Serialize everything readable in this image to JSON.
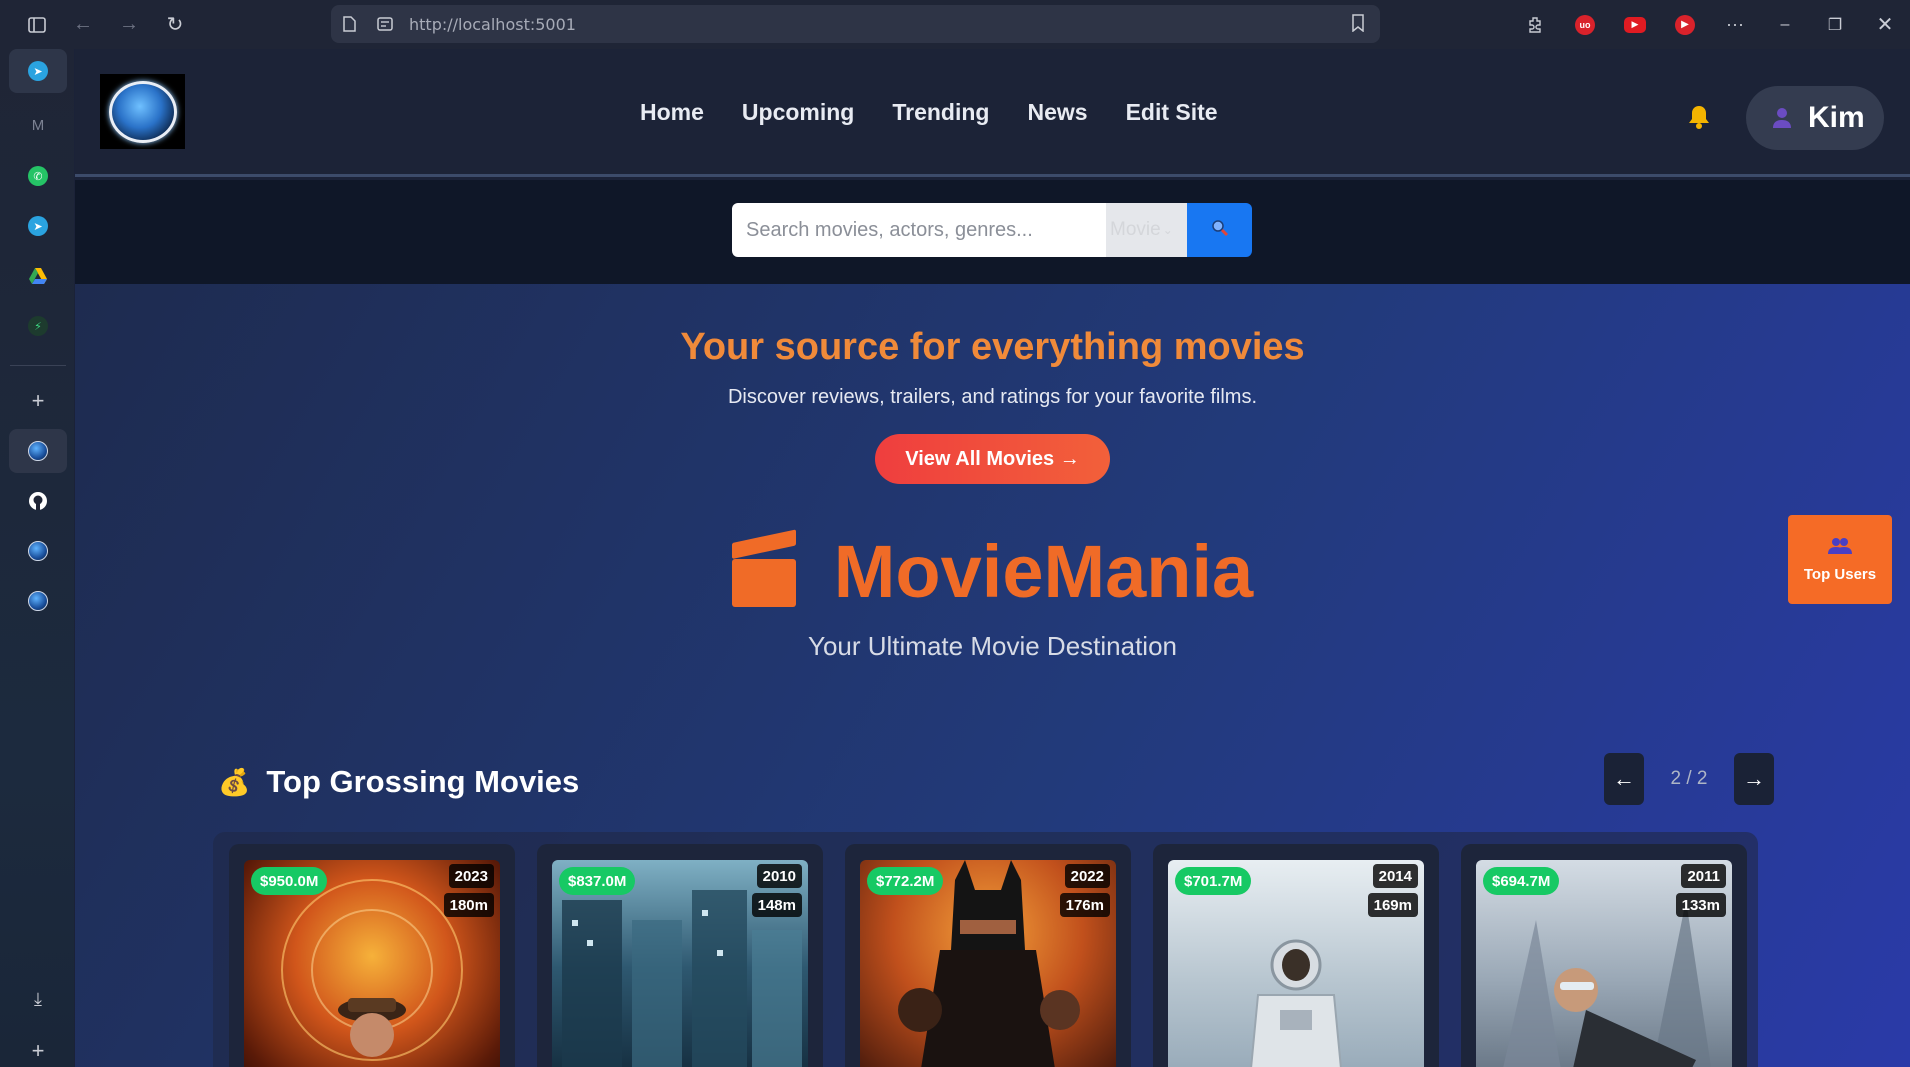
{
  "browser": {
    "url": "http://localhost:5001"
  },
  "site": {
    "nav": [
      "Home",
      "Upcoming",
      "Trending",
      "News",
      "Edit Site"
    ],
    "user_name": "Kim"
  },
  "search": {
    "placeholder": "Search movies, actors, genres...",
    "type_value": "Movie",
    "button_icon": "search-icon"
  },
  "hero": {
    "title": "Your source for everything movies",
    "subtitle": "Discover reviews, trailers, and ratings for your favorite films.",
    "cta_label": "View All Movies →",
    "brand_name": "MovieMania",
    "tagline": "Your Ultimate Movie Destination"
  },
  "section": {
    "title": "Top Grossing Movies",
    "page_indicator": "2 / 2",
    "prev_label": "←",
    "next_label": "→"
  },
  "movies": [
    {
      "gross": "$950.0M",
      "year": "2023",
      "length": "180m"
    },
    {
      "gross": "$837.0M",
      "year": "2010",
      "length": "148m"
    },
    {
      "gross": "$772.2M",
      "year": "2022",
      "length": "176m"
    },
    {
      "gross": "$701.7M",
      "year": "2014",
      "length": "169m"
    },
    {
      "gross": "$694.7M",
      "year": "2011",
      "length": "133m"
    }
  ],
  "floating": {
    "top_users_label": "Top Users"
  },
  "colors": {
    "accent_orange": "#f06b27",
    "gross_badge": "#17c964",
    "search_button": "#1877f2"
  }
}
